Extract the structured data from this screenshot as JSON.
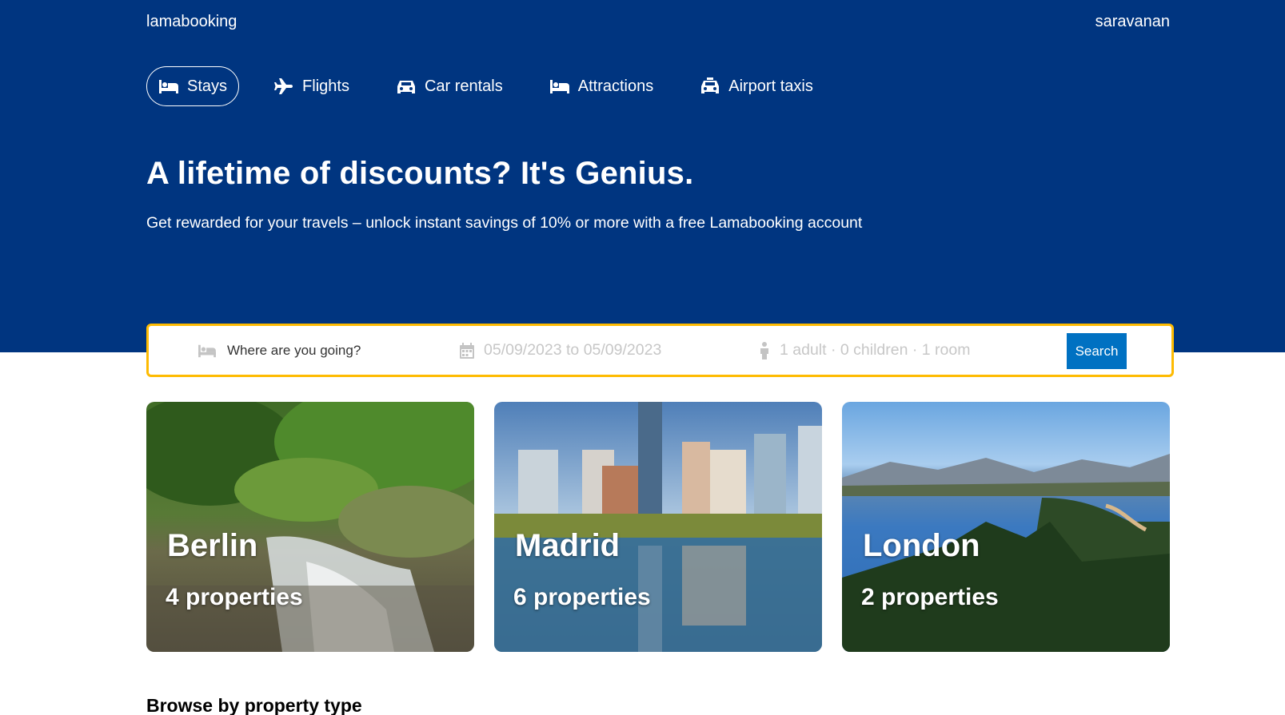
{
  "header": {
    "logo": "lamabooking",
    "user": "saravanan"
  },
  "nav": {
    "items": [
      {
        "label": "Stays",
        "icon": "bed-icon",
        "active": true
      },
      {
        "label": "Flights",
        "icon": "plane-icon",
        "active": false
      },
      {
        "label": "Car rentals",
        "icon": "car-icon",
        "active": false
      },
      {
        "label": "Attractions",
        "icon": "bed-icon",
        "active": false
      },
      {
        "label": "Airport taxis",
        "icon": "taxi-icon",
        "active": false
      }
    ]
  },
  "hero": {
    "title": "A lifetime of discounts? It's Genius.",
    "subtitle": "Get rewarded for your travels – unlock instant savings of 10% or more with a free Lamabooking account"
  },
  "search": {
    "destination_placeholder": "Where are you going?",
    "dates": "05/09/2023 to 05/09/2023",
    "guests": "1 adult · 0 children · 1 room",
    "button_label": "Search"
  },
  "featured": [
    {
      "city": "Berlin",
      "count": "4 properties"
    },
    {
      "city": "Madrid",
      "count": "6 properties"
    },
    {
      "city": "London",
      "count": "2 properties"
    }
  ],
  "sections": {
    "property_type_title": "Browse by property type"
  },
  "colors": {
    "hero_bg": "#003580",
    "search_border": "#febb02",
    "search_button": "#0071c2"
  }
}
